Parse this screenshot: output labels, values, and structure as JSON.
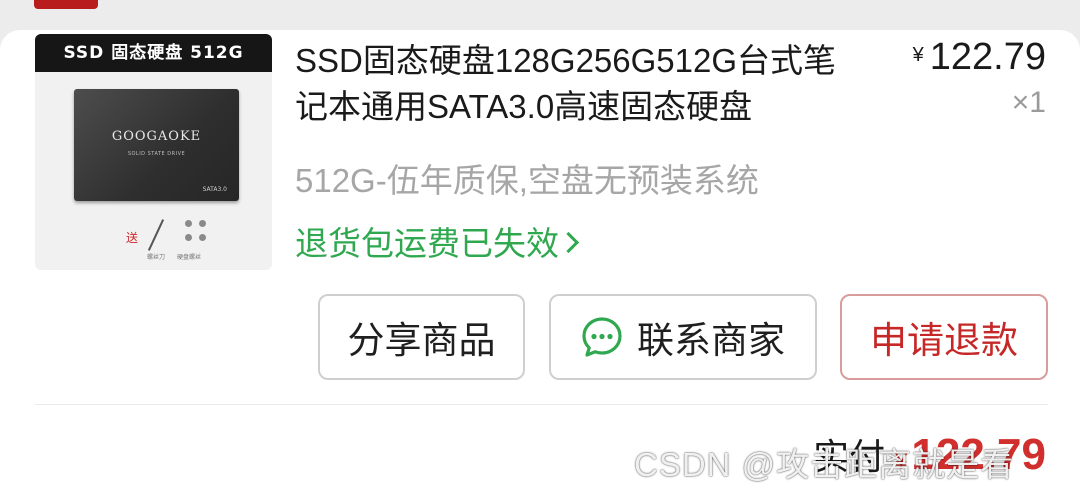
{
  "product": {
    "image_banner": "SSD 固态硬盘 512G",
    "image_brand": "GOOGAOKE",
    "image_subtitle": "SOLID STATE DRIVE",
    "image_model": "SATA3.0",
    "image_gift": "送",
    "image_caption_tool": "螺丝刀",
    "image_caption_screws": "硬盘螺丝",
    "title": "SSD固态硬盘128G256G512G台式笔记本通用SATA3.0高速固态硬盘",
    "price_currency": "¥",
    "price_amount": "122.79",
    "quantity": "×1",
    "spec": "512G-伍年质保,空盘无预装系统",
    "return_note": "退货包运费已失效"
  },
  "actions": {
    "share_label": "分享商品",
    "contact_label": "联系商家",
    "refund_label": "申请退款"
  },
  "payment": {
    "label": "实付",
    "currency": "¥",
    "amount": "122.79"
  },
  "watermark": "CSDN @攻击距离就是看",
  "colors": {
    "accent_green": "#2fa84f",
    "accent_red": "#c62828",
    "text_primary": "#1a1a1a",
    "text_secondary": "#a6a6a6"
  }
}
